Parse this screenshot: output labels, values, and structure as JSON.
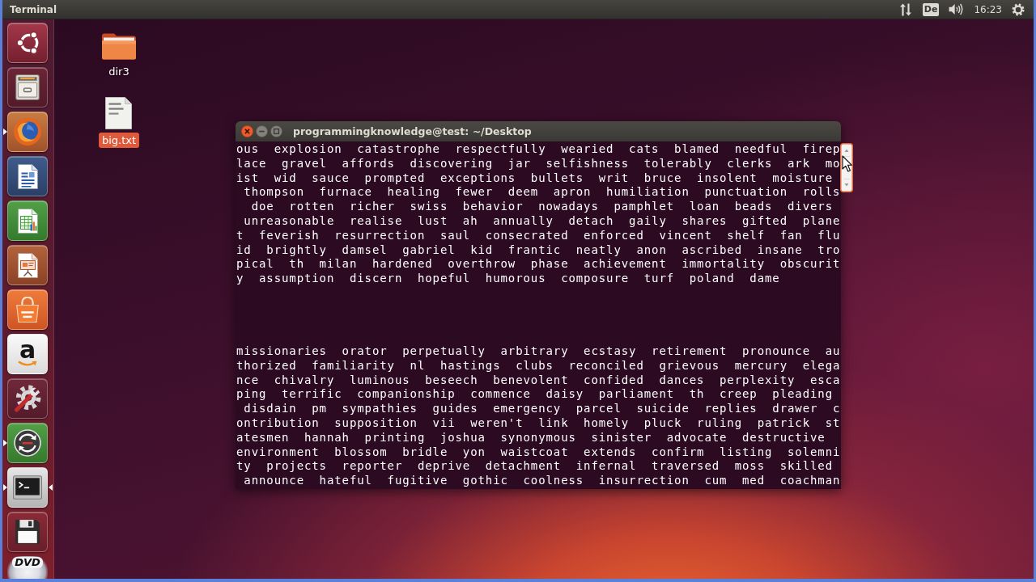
{
  "top_panel": {
    "app_name": "Terminal",
    "keyboard_layout": "De",
    "clock": "16:23"
  },
  "launcher": {
    "items": [
      {
        "kind": "dash",
        "running": false,
        "focused": false
      },
      {
        "kind": "files",
        "running": false,
        "focused": false
      },
      {
        "kind": "browser",
        "running": true,
        "focused": false
      },
      {
        "kind": "writer",
        "running": false,
        "focused": false
      },
      {
        "kind": "calc",
        "running": false,
        "focused": false
      },
      {
        "kind": "impress",
        "running": false,
        "focused": false
      },
      {
        "kind": "software-center",
        "running": false,
        "focused": false
      },
      {
        "kind": "amazon",
        "glyph": "a",
        "running": false,
        "focused": false
      },
      {
        "kind": "settings",
        "running": false,
        "focused": false
      },
      {
        "kind": "updater",
        "running": true,
        "focused": false
      },
      {
        "kind": "terminal",
        "running": true,
        "focused": true
      },
      {
        "kind": "floppy",
        "running": false,
        "focused": false
      },
      {
        "kind": "dvd",
        "glyph": "DVD",
        "running": false,
        "focused": false
      }
    ]
  },
  "desktop_icons": [
    {
      "label": "dir3",
      "kind": "folder",
      "selected": false
    },
    {
      "label": "big.txt",
      "kind": "text-file",
      "selected": true
    }
  ],
  "terminal": {
    "title": "programmingknowledge@test: ~/Desktop",
    "output_blocks": [
      {
        "lines": [
          "ous  explosion  catastrophe  respectfully  wearied  cats  blamed  needful  firep",
          "lace  gravel  affords  discovering  jar  selfishness  tolerably  clerks  ark  mo",
          "ist  wid  sauce  prompted  exceptions  bullets  writ  bruce  insolent  moisture",
          " thompson  furnace  healing  fewer  deem  apron  humiliation  punctuation  rolls",
          "  doe  rotten  richer  swiss  behavior  nowadays  pamphlet  loan  beads  divers",
          " unreasonable  realise  lust  ah  annually  detach  gaily  shares  gifted  plane",
          "t  feverish  resurrection  saul  consecrated  enforced  vincent  shelf  fan  flu",
          "id  brightly  damsel  gabriel  kid  frantic  neatly  anon  ascribed  insane  tro",
          "pical  th  milan  hardened  overthrow  phase  achievement  immortality  obscurit",
          "y  assumption  discern  hopeful  humorous  composure  turf  poland  dame"
        ]
      },
      {
        "lines": [
          "missionaries  orator  perpetually  arbitrary  ecstasy  retirement  pronounce  au",
          "thorized  familiarity  nl  hastings  clubs  reconciled  grievous  mercury  elega",
          "nce  chivalry  luminous  beseech  benevolent  confided  dances  perplexity  esca",
          "ping  terrific  companionship  commence  daisy  parliament  th  creep  pleading",
          " disdain  pm  sympathies  guides  emergency  parcel  suicide  replies  drawer  c",
          "ontribution  supposition  vii  weren't  link  homely  pluck  ruling  patrick  st",
          "atesmen  hannah  printing  joshua  synonymous  sinister  advocate  destructive",
          "environment  blossom  bridle  yon  waistcoat  extends  confirm  listing  solemni",
          "ty  projects  reporter  deprive  detachment  infernal  traversed  moss  skilled",
          " announce  hateful  fugitive  gothic  coolness  insurrection  cum  med  coachman"
        ]
      }
    ]
  }
}
